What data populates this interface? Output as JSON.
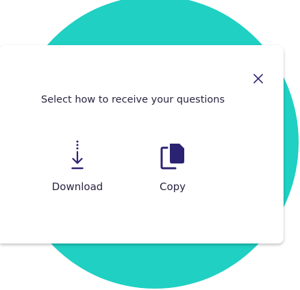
{
  "dialog": {
    "prompt": "Select how to receive your questions",
    "options": [
      {
        "label": "Download",
        "icon": "download-icon"
      },
      {
        "label": "Copy",
        "icon": "copy-icon"
      }
    ],
    "close_icon": "close-icon"
  },
  "colors": {
    "accent": "#1fd0c3",
    "icon_primary": "#2b2372",
    "text": "#2a2340"
  }
}
